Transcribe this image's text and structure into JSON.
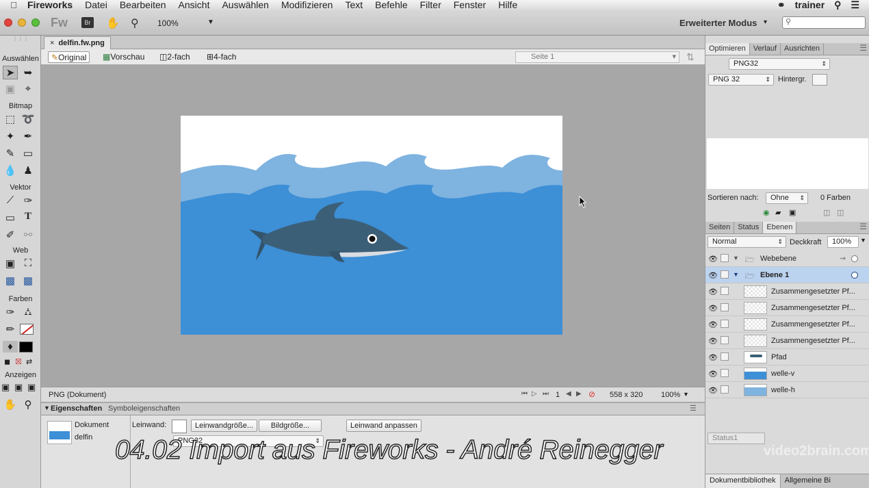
{
  "menubar": {
    "app": "Fireworks",
    "items": [
      "Datei",
      "Bearbeiten",
      "Ansicht",
      "Auswählen",
      "Modifizieren",
      "Text",
      "Befehle",
      "Filter",
      "Fenster",
      "Hilfe"
    ],
    "user": "trainer"
  },
  "appbar": {
    "logo": "Fw",
    "zoom": "100%",
    "mode": "Erweiterter Modus"
  },
  "tools": {
    "sections": [
      "Auswählen",
      "Bitmap",
      "Vektor",
      "Web",
      "Farben",
      "Anzeigen"
    ]
  },
  "document": {
    "tab": "delfin.fw.png",
    "views": [
      "Original",
      "Vorschau",
      "2-fach",
      "4-fach"
    ],
    "page": "Seite 1",
    "status_type": "PNG (Dokument)",
    "frame": "1",
    "size": "558 x 320",
    "zoom": "100%"
  },
  "properties": {
    "tabs": [
      "Eigenschaften",
      "Symboleigenschaften"
    ],
    "doc_label": "Dokument",
    "doc_name": "delfin",
    "canvas_label": "Leinwand:",
    "btn_canvas_size": "Leinwandgröße...",
    "btn_image_size": "Bildgröße...",
    "btn_fit": "Leinwand anpassen",
    "format": "PNG32"
  },
  "optimize": {
    "tabs": [
      "Optimieren",
      "Verlauf",
      "Ausrichten"
    ],
    "preset": "PNG32",
    "format": "PNG 32",
    "matte_label": "Hintergr.",
    "sort_label": "Sortieren nach:",
    "sort_value": "Ohne",
    "colors": "0 Farben"
  },
  "layers": {
    "tabs": [
      "Seiten",
      "Status",
      "Ebenen"
    ],
    "blend": "Normal",
    "opacity_label": "Deckkraft",
    "opacity": "100%",
    "groups": [
      "Webebene",
      "Ebene 1"
    ],
    "items": [
      "Zusammengesetzter Pf...",
      "Zusammengesetzter Pf...",
      "Zusammengesetzter Pf...",
      "Zusammengesetzter Pf...",
      "Pfad",
      "welle-v",
      "welle-h"
    ],
    "footer": "Status1"
  },
  "bottom_tabs": [
    "Dokumentbibliothek",
    "Allgemeine Bi"
  ],
  "overlay": {
    "title": "04.02 Import aus Fireworks - André Reinegger",
    "watermark": "video2brain.com"
  },
  "colors": {
    "sea": "#3d8fd6",
    "wave": "#7fb3e0",
    "dolphin": "#3c5f78",
    "selected_layer": "#bcd3ef"
  }
}
